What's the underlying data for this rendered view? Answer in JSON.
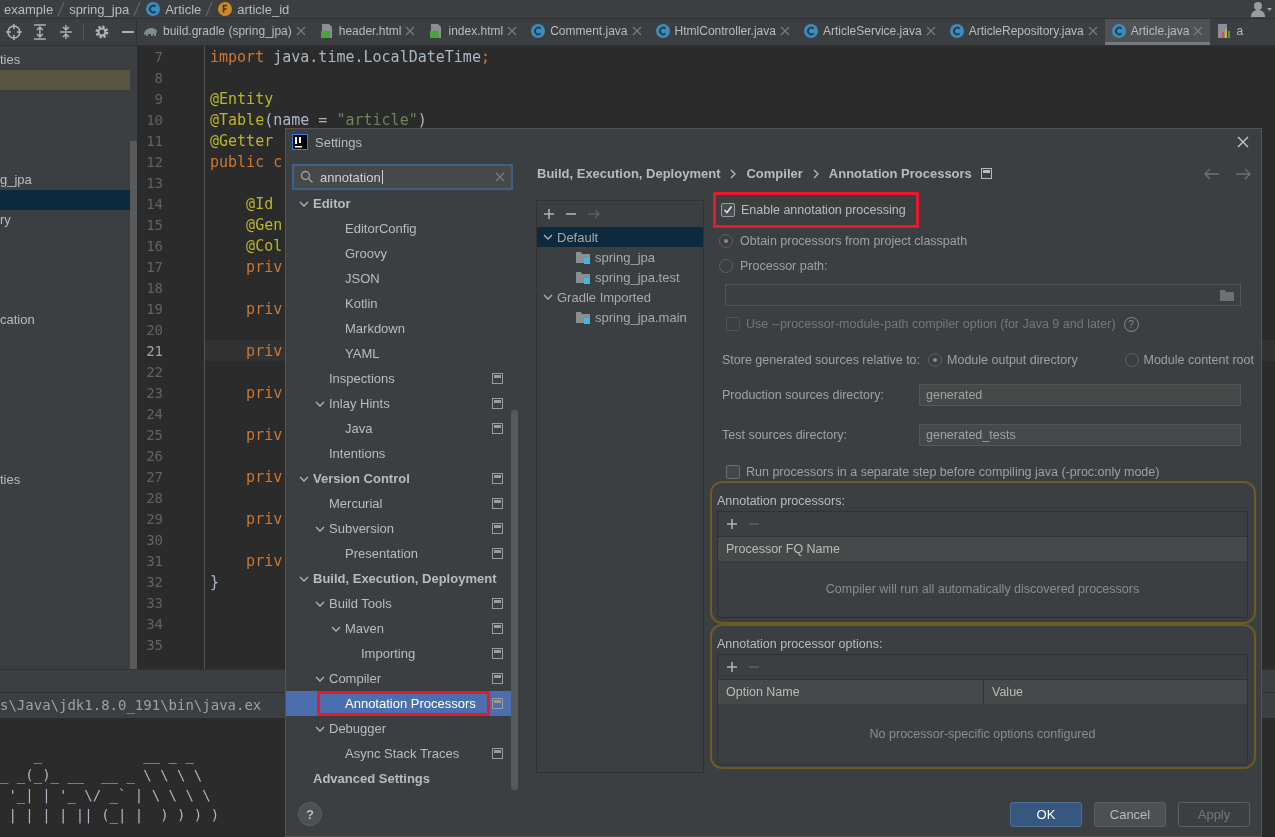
{
  "breadcrumbs": [
    {
      "label": "example",
      "kind": "directory"
    },
    {
      "label": "spring_jpa",
      "kind": "directory"
    },
    {
      "label": "Article",
      "kind": "class"
    },
    {
      "label": "article_id",
      "kind": "field"
    }
  ],
  "editor_tabs": [
    {
      "label": "build.gradle (spring_jpa)",
      "kind": "gradle",
      "selected": false,
      "closable": true
    },
    {
      "label": "header.html",
      "kind": "html",
      "selected": false,
      "closable": true
    },
    {
      "label": "index.html",
      "kind": "html",
      "selected": false,
      "closable": true
    },
    {
      "label": "Comment.java",
      "kind": "class",
      "selected": false,
      "closable": true
    },
    {
      "label": "HtmlController.java",
      "kind": "class",
      "selected": false,
      "closable": true
    },
    {
      "label": "ArticleService.java",
      "kind": "class",
      "selected": false,
      "closable": true
    },
    {
      "label": "ArticleRepository.java",
      "kind": "class",
      "selected": false,
      "closable": true
    },
    {
      "label": "Article.java",
      "kind": "class",
      "selected": true,
      "closable": true
    },
    {
      "label": "a",
      "kind": "chart",
      "selected": false,
      "closable": false
    }
  ],
  "project_rows": [
    {
      "label": "ties",
      "selected": false,
      "marked": false
    },
    {
      "selected": false,
      "marked": true
    },
    {
      "selected": false,
      "marked": false
    },
    {
      "selected": false,
      "marked": false
    },
    {
      "selected": false,
      "marked": false
    },
    {
      "selected": false,
      "marked": false
    },
    {
      "label": "g_jpa",
      "selected": false,
      "marked": false
    },
    {
      "selected": true,
      "marked": false
    },
    {
      "label": "ry",
      "selected": false,
      "marked": false
    },
    {
      "selected": false,
      "marked": false
    },
    {
      "selected": false,
      "marked": false
    },
    {
      "selected": false,
      "marked": false
    },
    {
      "selected": false,
      "marked": false
    },
    {
      "label": "cation",
      "selected": false,
      "marked": false
    },
    {
      "selected": false,
      "marked": false
    },
    {
      "selected": false,
      "marked": false
    },
    {
      "selected": false,
      "marked": false
    },
    {
      "selected": false,
      "marked": false
    },
    {
      "selected": false,
      "marked": false
    },
    {
      "selected": false,
      "marked": false
    },
    {
      "selected": false,
      "marked": false
    },
    {
      "label": "ties",
      "selected": false,
      "marked": false
    }
  ],
  "code_lines": [
    {
      "number": "7",
      "current": false,
      "tokens": [
        {
          "kind": "keyword",
          "text": "import"
        },
        {
          "kind": "plain",
          "text": " java.time.LocalDateTime"
        },
        {
          "kind": "keyword",
          "text": ";"
        }
      ]
    },
    {
      "number": "8",
      "current": false
    },
    {
      "number": "9",
      "current": false,
      "tokens": [
        {
          "kind": "annotation",
          "text": "@Entity"
        }
      ]
    },
    {
      "number": "10",
      "current": false,
      "tokens": [
        {
          "kind": "annotation",
          "text": "@Table"
        },
        {
          "kind": "plain",
          "text": "(name = "
        },
        {
          "kind": "string",
          "text": "\"article\""
        },
        {
          "kind": "plain",
          "text": ")"
        }
      ]
    },
    {
      "number": "11",
      "current": false,
      "tokens": [
        {
          "kind": "annotation",
          "text": "@Getter"
        }
      ]
    },
    {
      "number": "12",
      "current": false,
      "tokens": [
        {
          "kind": "keyword",
          "text": "public c"
        }
      ]
    },
    {
      "number": "13",
      "current": false
    },
    {
      "number": "14",
      "current": false,
      "tokens": [
        {
          "kind": "annotation",
          "text": "    @Id"
        }
      ]
    },
    {
      "number": "15",
      "current": false,
      "tokens": [
        {
          "kind": "annotation",
          "text": "    @Gen"
        }
      ]
    },
    {
      "number": "16",
      "current": false,
      "tokens": [
        {
          "kind": "annotation",
          "text": "    @Col"
        }
      ]
    },
    {
      "number": "17",
      "current": false,
      "tokens": [
        {
          "kind": "keyword",
          "text": "    priv"
        }
      ]
    },
    {
      "number": "18",
      "current": false
    },
    {
      "number": "19",
      "current": false,
      "tokens": [
        {
          "kind": "keyword",
          "text": "    priv"
        }
      ]
    },
    {
      "number": "20",
      "current": false
    },
    {
      "number": "21",
      "current": true,
      "tokens": [
        {
          "kind": "keyword",
          "text": "    priv"
        }
      ]
    },
    {
      "number": "22",
      "current": false
    },
    {
      "number": "23",
      "current": false,
      "tokens": [
        {
          "kind": "keyword",
          "text": "    priv"
        }
      ]
    },
    {
      "number": "24",
      "current": false
    },
    {
      "number": "25",
      "current": false,
      "tokens": [
        {
          "kind": "keyword",
          "text": "    priv"
        }
      ]
    },
    {
      "number": "26",
      "current": false
    },
    {
      "number": "27",
      "current": false,
      "tokens": [
        {
          "kind": "keyword",
          "text": "    priv"
        }
      ]
    },
    {
      "number": "28",
      "current": false
    },
    {
      "number": "29",
      "current": false,
      "tokens": [
        {
          "kind": "keyword",
          "text": "    priv"
        }
      ]
    },
    {
      "number": "30",
      "current": false
    },
    {
      "number": "31",
      "current": false,
      "tokens": [
        {
          "kind": "keyword",
          "text": "    priv"
        }
      ]
    },
    {
      "number": "32",
      "current": false,
      "tokens": [
        {
          "kind": "plain",
          "text": "}"
        }
      ]
    },
    {
      "number": "33",
      "current": false
    },
    {
      "number": "34",
      "current": false
    },
    {
      "number": "35",
      "current": false
    }
  ],
  "console": {
    "path": "s\\Java\\jdk1.8.0_191\\bin\\java.ex",
    "banner": "    _            __ _ _\n_ _(_)_ __  __ _ \\ \\ \\ \\\n '_| | '_ \\/ _` | \\ \\ \\ \\\n | | | | || (_| |  ) ) ) )"
  },
  "settings_dialog": {
    "title": "Settings",
    "search": {
      "value": "annotation"
    },
    "tree": [
      {
        "label": "Editor",
        "kind": "section",
        "expanded": true,
        "selected": false,
        "project_level": false,
        "children": [
          {
            "children": [
              {
                "label": "EditorConfig",
                "kind": "page",
                "selected": false,
                "project_level": false
              },
              {
                "label": "Groovy",
                "kind": "page",
                "selected": false,
                "project_level": false
              },
              {
                "label": "JSON",
                "kind": "page",
                "selected": false,
                "project_level": false
              },
              {
                "label": "Kotlin",
                "kind": "page",
                "selected": false,
                "project_level": false
              },
              {
                "label": "Markdown",
                "kind": "page",
                "selected": false,
                "project_level": false
              },
              {
                "label": "YAML",
                "kind": "page",
                "selected": false,
                "project_level": false
              }
            ]
          },
          {
            "label": "Inspections",
            "kind": "page",
            "selected": false,
            "project_level": true
          },
          {
            "label": "Inlay Hints",
            "kind": "page",
            "expanded": true,
            "selected": false,
            "project_level": true,
            "children": [
              {
                "label": "Java",
                "kind": "page",
                "selected": false,
                "project_level": true
              }
            ]
          },
          {
            "label": "Intentions",
            "kind": "page",
            "selected": false,
            "project_level": false
          }
        ]
      },
      {
        "label": "Version Control",
        "kind": "section",
        "expanded": true,
        "selected": false,
        "project_level": true,
        "children": [
          {
            "label": "Mercurial",
            "kind": "page",
            "selected": false,
            "project_level": true
          },
          {
            "label": "Subversion",
            "kind": "page",
            "expanded": true,
            "selected": false,
            "project_level": true,
            "children": [
              {
                "label": "Presentation",
                "kind": "page",
                "selected": false,
                "project_level": true
              }
            ]
          }
        ]
      },
      {
        "label": "Build, Execution, Deployment",
        "kind": "section",
        "expanded": true,
        "selected": false,
        "project_level": false,
        "children": [
          {
            "label": "Build Tools",
            "kind": "page",
            "expanded": true,
            "selected": false,
            "project_level": true,
            "children": [
              {
                "label": "Maven",
                "kind": "page",
                "expanded": true,
                "selected": false,
                "project_level": true,
                "children": [
                  {
                    "label": "Importing",
                    "kind": "page",
                    "selected": false,
                    "project_level": true
                  }
                ]
              }
            ]
          },
          {
            "label": "Compiler",
            "kind": "page",
            "expanded": true,
            "selected": false,
            "project_level": true,
            "children": [
              {
                "label": "Annotation Processors",
                "kind": "page",
                "selected": true,
                "highlighted": true,
                "project_level": true
              }
            ]
          },
          {
            "label": "Debugger",
            "kind": "page",
            "expanded": true,
            "selected": false,
            "project_level": false,
            "children": [
              {
                "label": "Async Stack Traces",
                "kind": "page",
                "selected": false,
                "project_level": true
              }
            ]
          }
        ]
      },
      {
        "label": "Advanced Settings",
        "kind": "section",
        "selected": false,
        "project_level": false
      }
    ],
    "breadcrumb": [
      "Build, Execution, Deployment",
      "Compiler",
      "Annotation Processors"
    ],
    "profiles": [
      {
        "label": "Default",
        "kind": "profile",
        "expanded": true,
        "selected": true,
        "children": [
          {
            "label": "spring_jpa",
            "kind": "module",
            "selected": false
          },
          {
            "label": "spring_jpa.test",
            "kind": "module",
            "selected": false
          }
        ]
      },
      {
        "label": "Gradle Imported",
        "kind": "profile",
        "expanded": true,
        "selected": false,
        "children": [
          {
            "label": "spring_jpa.main",
            "kind": "module",
            "selected": false
          }
        ]
      }
    ],
    "enable_processing": {
      "label": "Enable annotation processing",
      "checked": true,
      "highlighted": true
    },
    "processor_source": [
      {
        "label": "Obtain processors from project classpath",
        "selected": true
      },
      {
        "label": "Processor path:",
        "selected": false
      }
    ],
    "module_path_option": {
      "label": "Use --processor-module-path compiler option (for Java 9 and later)",
      "checked": false,
      "disabled": true,
      "help": "?"
    },
    "store_relative": {
      "label": "Store generated sources relative to:",
      "options": [
        {
          "label": "Module output directory",
          "selected": true
        },
        {
          "label": "Module content root",
          "selected": false
        }
      ]
    },
    "directories": [
      {
        "label": "Production sources directory:",
        "value": "generated"
      },
      {
        "label": "Test sources directory:",
        "value": "generated_tests"
      }
    ],
    "proc_only": {
      "label": "Run processors in a separate step before compiling java (-proc:only mode)",
      "checked": false,
      "disabled": false
    },
    "tables": [
      {
        "title": "Annotation processors:",
        "columns": [
          "Processor FQ Name"
        ],
        "empty_text": "Compiler will run all automatically discovered processors"
      },
      {
        "title": "Annotation processor options:",
        "columns": [
          "Option Name",
          "Value"
        ],
        "empty_text": "No processor-specific options configured"
      }
    ],
    "help": "?",
    "buttons": [
      {
        "label": "OK",
        "kind": "primary"
      },
      {
        "label": "Cancel",
        "kind": "normal"
      },
      {
        "label": "Apply",
        "kind": "disabled"
      }
    ]
  }
}
